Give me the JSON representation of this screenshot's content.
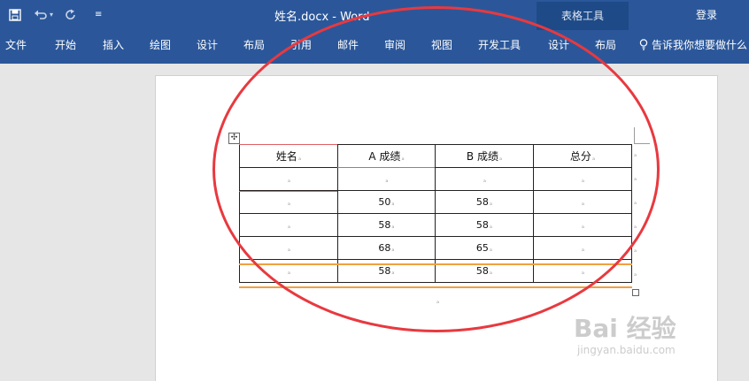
{
  "titlebar": {
    "document_title": "姓名.docx  -  Word",
    "context_group": "表格工具",
    "login": "登录",
    "qat_icons": [
      "save-icon",
      "undo-icon",
      "redo-icon",
      "customize-icon"
    ]
  },
  "ribbon": {
    "tabs": [
      "文件",
      "开始",
      "插入",
      "绘图",
      "设计",
      "布局",
      "引用",
      "邮件",
      "审阅",
      "视图",
      "开发工具",
      "设计",
      "布局"
    ],
    "tell_me": "告诉我你想要做什么"
  },
  "table": {
    "headers": [
      "姓名",
      "A 成绩",
      "B 成绩",
      "总分"
    ],
    "rows": [
      [
        "",
        "",
        "",
        ""
      ],
      [
        "",
        "50",
        "58",
        ""
      ],
      [
        "",
        "58",
        "58",
        ""
      ],
      [
        "",
        "68",
        "65",
        ""
      ],
      [
        "",
        "58",
        "58",
        ""
      ]
    ]
  },
  "watermark": {
    "text": "Bai 经验",
    "url": "jingyan.baidu.com"
  },
  "colors": {
    "ribbon_blue": "#2b579a",
    "context_group": "#1e4a87",
    "annotation_circle": "#e8393f"
  }
}
